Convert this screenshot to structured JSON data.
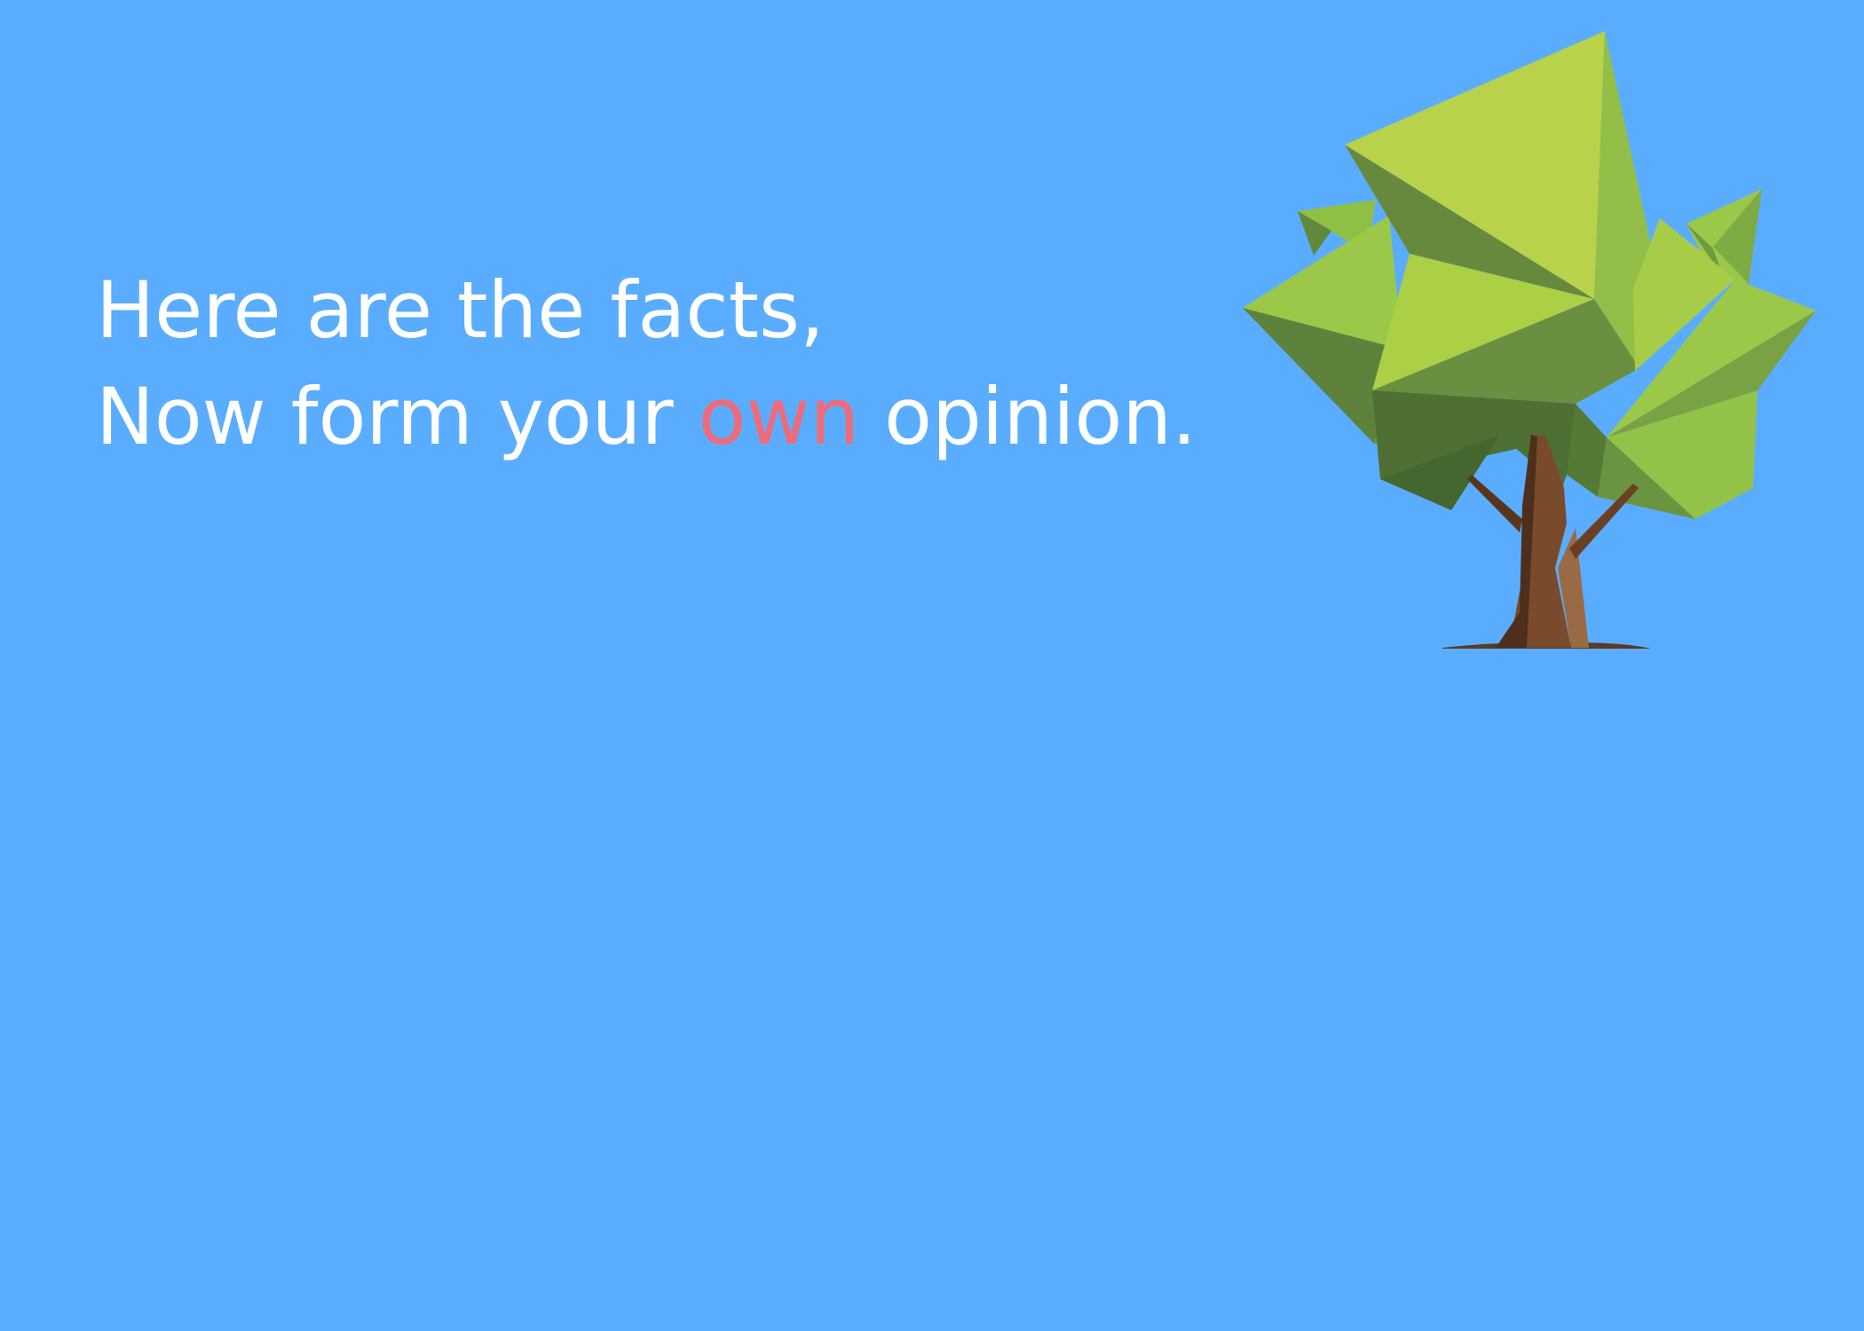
{
  "slide": {
    "background_color": "#5aadfe",
    "headline": {
      "line1": "Here are the facts,",
      "line2_before": "Now form your ",
      "line2_emphasis": "own",
      "line2_after": " opinion.",
      "text_color": "#ffffff",
      "emphasis_color": "#ee6b7c"
    },
    "illustration": {
      "icon": "low-poly-tree-icon"
    }
  }
}
